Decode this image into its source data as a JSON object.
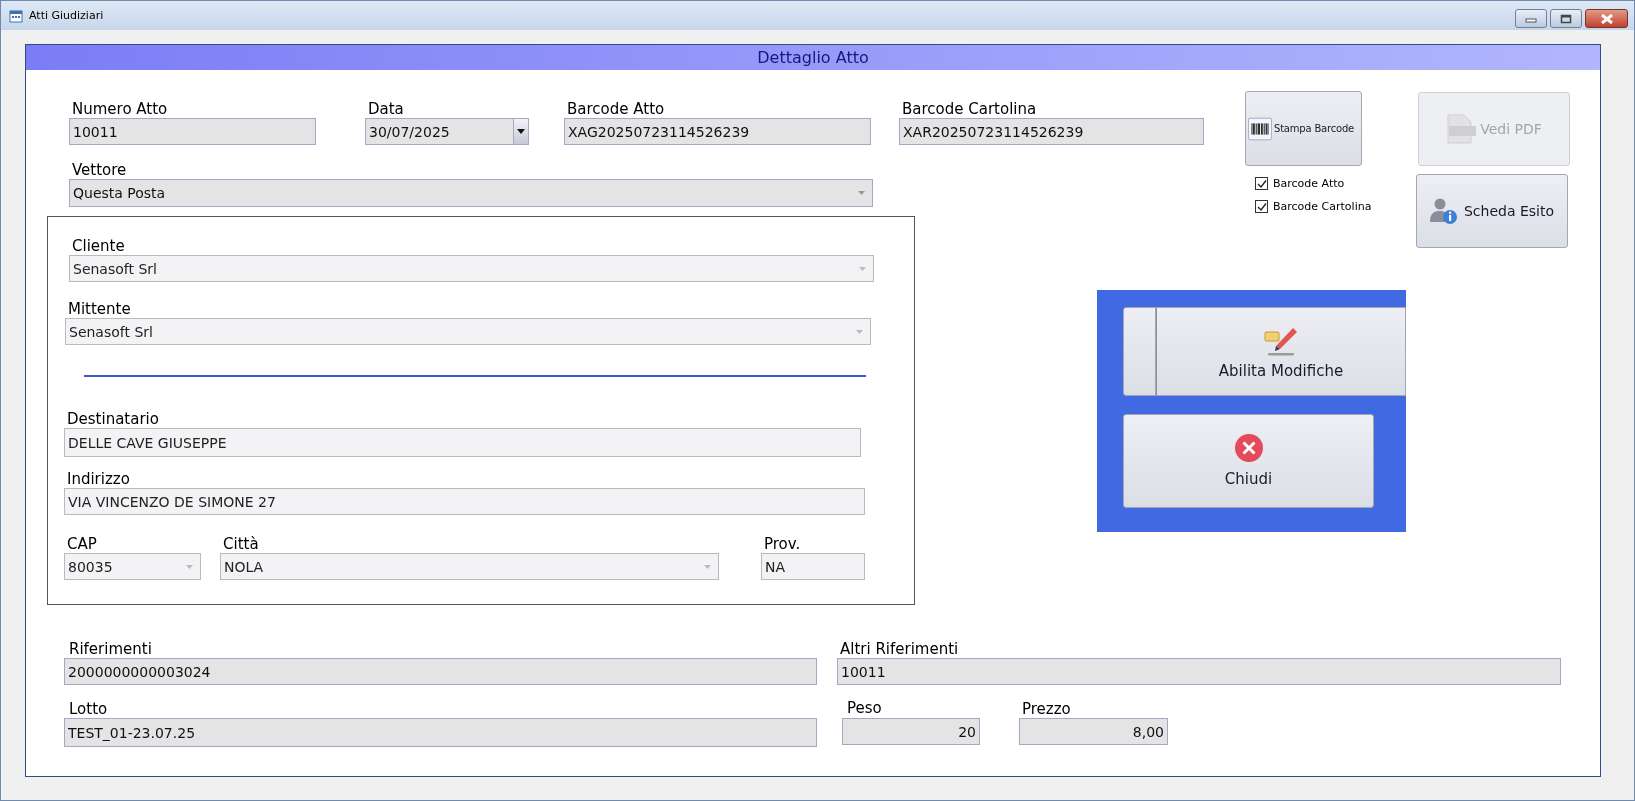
{
  "window": {
    "title": "Atti Giudiziari"
  },
  "header": {
    "title": "Dettaglio Atto"
  },
  "numero_atto": {
    "label": "Numero Atto",
    "value": "10011",
    "disabled": false
  },
  "data": {
    "label": "Data",
    "value": "30/07/2025",
    "disabled": false
  },
  "barcode_atto": {
    "label": "Barcode Atto",
    "value": "XAG20250723114526239",
    "disabled": false
  },
  "barcode_cartolina": {
    "label": "Barcode Cartolina",
    "value": "XAR20250723114526239",
    "disabled": false
  },
  "vettore": {
    "label": "Vettore",
    "value": "Questa Posta",
    "disabled": false
  },
  "cliente": {
    "label": "Cliente",
    "value": "Senasoft Srl",
    "disabled": true
  },
  "mittente": {
    "label": "Mittente",
    "value": "Senasoft Srl",
    "disabled": true
  },
  "destinatario": {
    "label": "Destinatario",
    "value": "DELLE CAVE GIUSEPPE",
    "disabled": true
  },
  "indirizzo": {
    "label": "Indirizzo",
    "value": "VIA VINCENZO DE SIMONE 27",
    "disabled": true
  },
  "cap": {
    "label": "CAP",
    "value": "80035",
    "disabled": true
  },
  "citta": {
    "label": "Città",
    "value": "NOLA",
    "disabled": true
  },
  "prov": {
    "label": "Prov.",
    "value": "NA",
    "disabled": true
  },
  "riferimenti": {
    "label": "Riferimenti",
    "value": "2000000000003024",
    "disabled": false
  },
  "altri_riferimenti": {
    "label": "Altri Riferimenti",
    "value": "10011",
    "disabled": false
  },
  "lotto": {
    "label": "Lotto",
    "value": "TEST_01-23.07.25",
    "disabled": false
  },
  "peso": {
    "label": "Peso",
    "value": "20",
    "disabled": false
  },
  "prezzo": {
    "label": "Prezzo",
    "value": "8,00",
    "disabled": false
  },
  "stampa_barcode": {
    "label": "Stampa Barcode",
    "disabled": false
  },
  "vedi_pdf": {
    "label": "Vedi PDF",
    "disabled": true
  },
  "barcode_options": [
    {
      "label": "Barcode Atto",
      "checked": true
    },
    {
      "label": "Barcode Cartolina",
      "checked": true
    }
  ],
  "scheda_esito": {
    "label": "Scheda Esito",
    "disabled": false
  },
  "abilita_modifiche": {
    "label": "Abilita Modifiche"
  },
  "chiudi": {
    "label": "Chiudi"
  }
}
